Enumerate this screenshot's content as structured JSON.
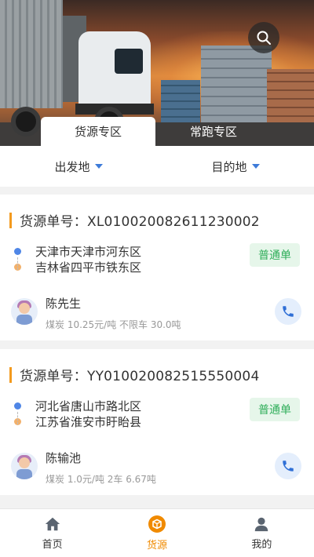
{
  "hero": {
    "tabs": [
      {
        "label": "货源专区",
        "active": true
      },
      {
        "label": "常跑专区",
        "active": false
      }
    ]
  },
  "filters": {
    "origin_label": "出发地",
    "destination_label": "目的地"
  },
  "cards": [
    {
      "title": "货源单号：XL010020082611230002",
      "from": "天津市天津市河东区",
      "to": "吉林省四平市铁东区",
      "badge": "普通单",
      "contact_name": "陈先生",
      "detail": "煤炭 10.25元/吨 不限车 30.0吨"
    },
    {
      "title": "货源单号：YY010020082515550004",
      "from": "河北省唐山市路北区",
      "to": "江苏省淮安市盱眙县",
      "badge": "普通单",
      "contact_name": "陈输池",
      "detail": "煤炭 1.0元/吨 2车 6.67吨"
    }
  ],
  "bottom_nav": [
    {
      "label": "首页",
      "icon": "home-icon",
      "active": false
    },
    {
      "label": "货源",
      "icon": "cargo-icon",
      "active": true
    },
    {
      "label": "我的",
      "icon": "user-icon",
      "active": false
    }
  ],
  "colors": {
    "accent": "#f08a00",
    "title_bar": "#f39a1e",
    "badge_bg": "#e6f6ea",
    "badge_text": "#2fae5a",
    "from_dot": "#4f86e6",
    "to_dot": "#f2b06b",
    "call_icon": "#2f6fd6"
  }
}
